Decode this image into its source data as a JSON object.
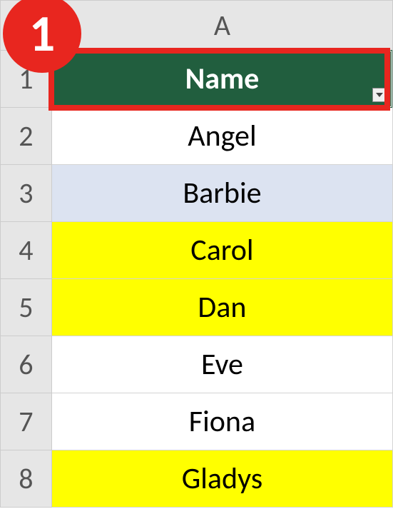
{
  "callout": {
    "number": "1"
  },
  "columns": {
    "A": "A"
  },
  "rowNumbers": {
    "r1": "1",
    "r2": "2",
    "r3": "3",
    "r4": "4",
    "r5": "5",
    "r6": "6",
    "r7": "7",
    "r8": "8"
  },
  "cells": {
    "header": "Name",
    "r2": "Angel",
    "r3": "Barbie",
    "r4": "Carol",
    "r5": "Dan",
    "r6": "Eve",
    "r7": "Fiona",
    "r8": "Gladys"
  },
  "fills": {
    "r2": "white",
    "r3": "lightblue",
    "r4": "yellow",
    "r5": "yellow",
    "r6": "white",
    "r7": "white",
    "r8": "yellow"
  },
  "chart_data": {
    "type": "table",
    "title": "Name",
    "columns": [
      "Name"
    ],
    "rows": [
      {
        "Name": "Angel",
        "fill": "none"
      },
      {
        "Name": "Barbie",
        "fill": "lightblue"
      },
      {
        "Name": "Carol",
        "fill": "yellow"
      },
      {
        "Name": "Dan",
        "fill": "yellow"
      },
      {
        "Name": "Eve",
        "fill": "none"
      },
      {
        "Name": "Fiona",
        "fill": "none"
      },
      {
        "Name": "Gladys",
        "fill": "yellow"
      }
    ]
  }
}
